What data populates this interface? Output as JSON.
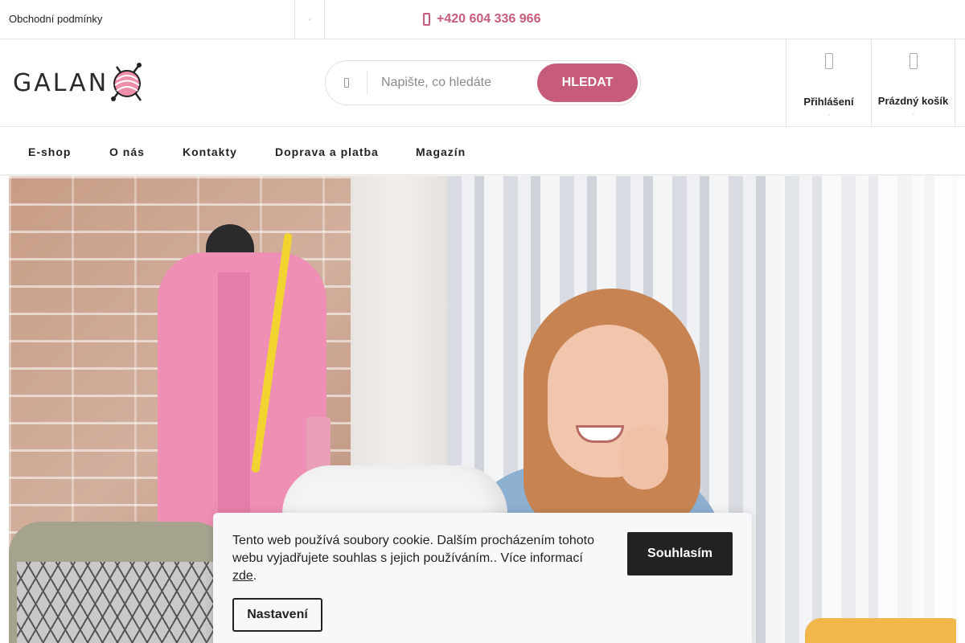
{
  "topbar": {
    "terms_link": "Obchodní podmínky",
    "phone": "+420 604 336 966",
    "icons": [
      "chevron-icon",
      "phone-icon"
    ]
  },
  "header": {
    "logo_text": "GALAN",
    "logo_icon": "yarn-ball-icon",
    "search": {
      "placeholder": "Napište, co hledáte",
      "button_label": "HLEDAT",
      "icon": "search-icon"
    },
    "login": {
      "label": "Přihlášení",
      "icon": "user-icon"
    },
    "cart": {
      "label": "Prázdný košík",
      "icon": "cart-icon"
    }
  },
  "nav": {
    "items": [
      {
        "label": "E-shop"
      },
      {
        "label": "O nás"
      },
      {
        "label": "Kontakty"
      },
      {
        "label": "Doprava a platba"
      },
      {
        "label": "Magazín"
      }
    ]
  },
  "cookie": {
    "text": "Tento web používá soubory cookie. Dalším procházením tohoto webu vyjadřujete souhlas s jejich používáním.. Více informací",
    "link_label": "zde",
    "trailing": ".",
    "agree_label": "Souhlasím",
    "settings_label": "Nastavení"
  },
  "colors": {
    "accent": "#c75b7a",
    "dark": "#222222",
    "border": "#e4e4e4"
  }
}
